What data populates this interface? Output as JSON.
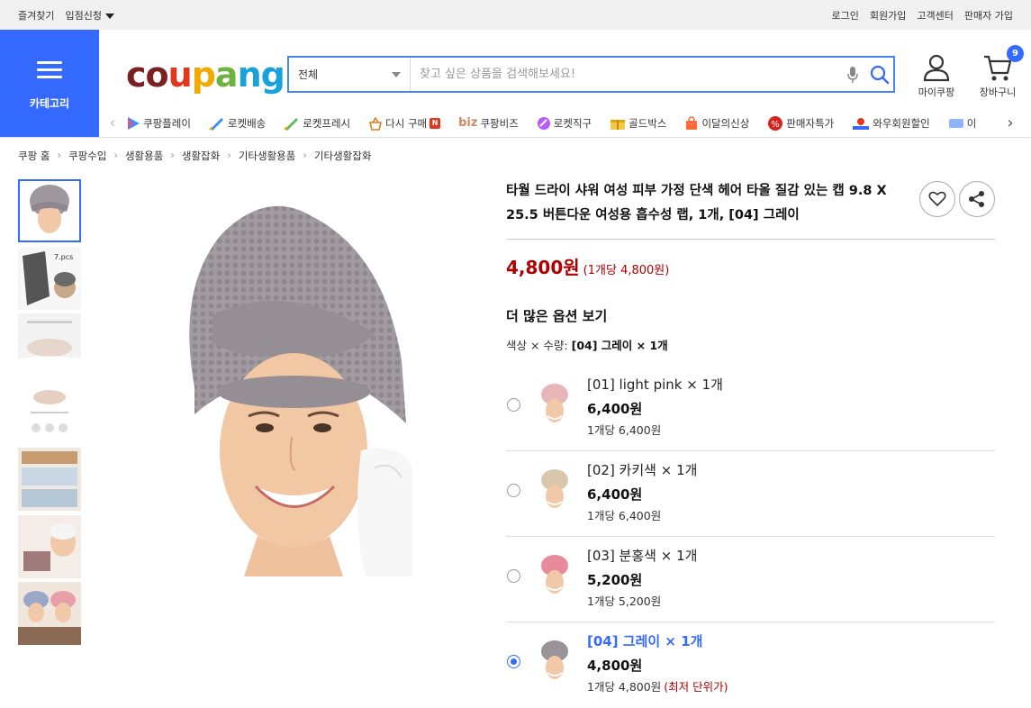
{
  "topbar": {
    "favorites": "즐겨찾기",
    "vendor_apply": "입점신청",
    "login": "로그인",
    "signup": "회원가입",
    "customer_center": "고객센터",
    "seller_signup": "판매자 가입"
  },
  "header": {
    "category_label": "카테고리",
    "logo": {
      "c": "c",
      "o": "o",
      "u": "u",
      "p": "p",
      "a": "a",
      "n": "n",
      "g": "g"
    },
    "search_category": "전체",
    "search_placeholder": "찾고 싶은 상품을 검색해보세요!",
    "my_coupang": "마이쿠팡",
    "cart_label": "장바구니",
    "cart_count": "9"
  },
  "strip": {
    "items": [
      "쿠팡플레이",
      "로켓배송",
      "로켓프레시",
      "다시 구매",
      "쿠팡비즈",
      "로켓직구",
      "골드박스",
      "이달의신상",
      "판매자특가",
      "와우회원할인",
      "이"
    ],
    "n_badge": "N",
    "biz_prefix": "biz"
  },
  "breadcrumb": [
    "쿠팡 홈",
    "쿠팡수입",
    "생활용품",
    "생활잡화",
    "기타생활용품",
    "기타생활잡화"
  ],
  "product": {
    "title": "타월 드라이 샤워 여성 피부 가정 단색 헤어 타올 질감 있는 캡 9.8 X 25.5 버튼다운 여성용 흡수성 랩, 1개, [04] 그레이",
    "price": "4,800원",
    "unit_price": "(1개당 4,800원)",
    "more_options": "더 많은 옵션 보기",
    "selection_label": "색상 × 수량:",
    "selection_value": "[04] 그레이 × 1개",
    "lowest_unit_note": "(최저 단위가)",
    "options": [
      {
        "name": "[01] light pink × 1개",
        "price": "6,400원",
        "unit": "1개당 6,400원",
        "color": "#e8b5b8",
        "selected": false
      },
      {
        "name": "[02] 카키색 × 1개",
        "price": "6,400원",
        "unit": "1개당 6,400원",
        "color": "#d9c7ad",
        "selected": false
      },
      {
        "name": "[03] 분홍색 × 1개",
        "price": "5,200원",
        "unit": "1개당 5,200원",
        "color": "#e88a9c",
        "selected": false
      },
      {
        "name": "[04] 그레이 × 1개",
        "price": "4,800원",
        "unit": "1개당 4,800원",
        "color": "#9a9399",
        "selected": true
      }
    ]
  },
  "colors": {
    "brand_blue": "#346aff",
    "price_red": "#ae0000",
    "towel_gray": "#9e979d"
  }
}
